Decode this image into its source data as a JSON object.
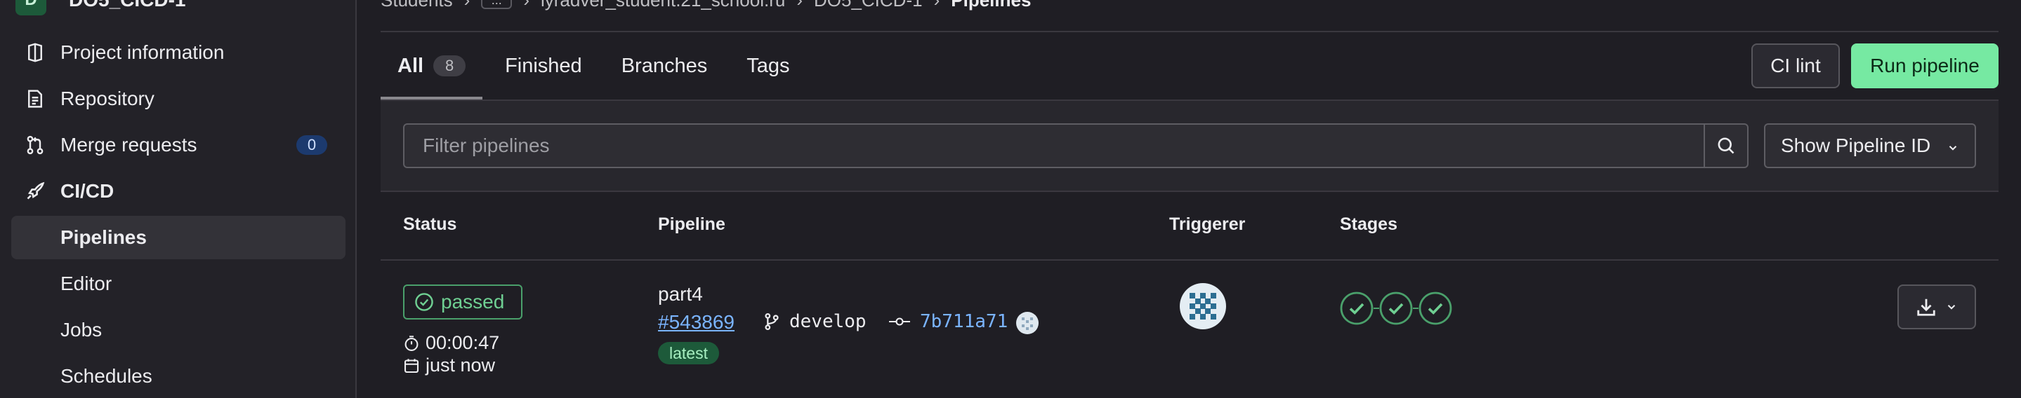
{
  "sidebar": {
    "project": {
      "initial": "D",
      "name": "DO5_CICD-1"
    },
    "items": [
      {
        "label": "Project information",
        "icon": "project-info-icon"
      },
      {
        "label": "Repository",
        "icon": "document-icon"
      },
      {
        "label": "Merge requests",
        "icon": "merge-request-icon",
        "badge": "0"
      },
      {
        "label": "CI/CD",
        "icon": "rocket-icon"
      },
      {
        "label": "Pipelines"
      },
      {
        "label": "Editor"
      },
      {
        "label": "Jobs"
      },
      {
        "label": "Schedules"
      }
    ]
  },
  "breadcrumb": {
    "items": [
      "Students",
      "...",
      "lyradver_student.21_school.ru",
      "DO5_CICD-1",
      "Pipelines"
    ]
  },
  "tabs": [
    {
      "label": "All",
      "count": "8"
    },
    {
      "label": "Finished"
    },
    {
      "label": "Branches"
    },
    {
      "label": "Tags"
    }
  ],
  "actions": {
    "ci_lint": "CI lint",
    "run_pipeline": "Run pipeline"
  },
  "filter": {
    "placeholder": "Filter pipelines",
    "select_value": "Show Pipeline ID"
  },
  "table": {
    "headers": [
      "Status",
      "Pipeline",
      "Triggerer",
      "Stages"
    ],
    "rows": [
      {
        "status": "passed",
        "duration": "00:00:47",
        "finished": "just now",
        "name": "part4",
        "id": "#543869",
        "branch": "develop",
        "commit": "7b711a71",
        "badge": "latest",
        "stages": [
          "passed",
          "passed",
          "passed"
        ]
      }
    ]
  },
  "colors": {
    "accent_green": "#76e9a2",
    "status_passed": "#4aa06b",
    "link_blue": "#7ab4ff"
  }
}
